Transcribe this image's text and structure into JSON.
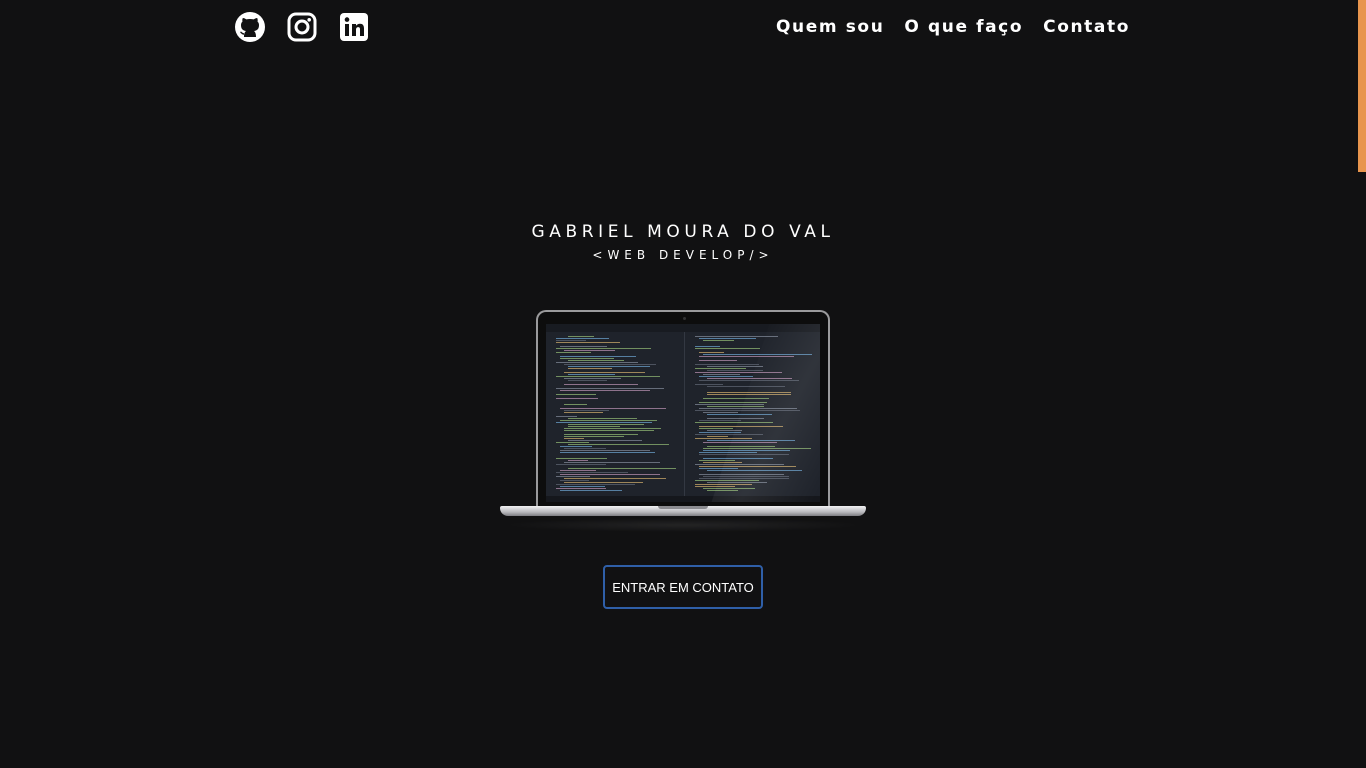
{
  "social": {
    "items": [
      {
        "icon": "github-icon"
      },
      {
        "icon": "instagram-icon"
      },
      {
        "icon": "linkedin-icon"
      }
    ]
  },
  "nav": {
    "items": [
      {
        "label": "Quem sou"
      },
      {
        "label": "O que faço"
      },
      {
        "label": "Contato"
      }
    ]
  },
  "hero": {
    "name": "GABRIEL MOURA DO VAL",
    "role": "<WEB DEVELOP/>",
    "image": "laptop-code-editor-image",
    "cta_label": "ENTRAR EM CONTATO"
  },
  "colors": {
    "background": "#111112",
    "text": "#ffffff",
    "cta_border": "#2f5fa8",
    "scroll_accent": "#e8954d"
  }
}
